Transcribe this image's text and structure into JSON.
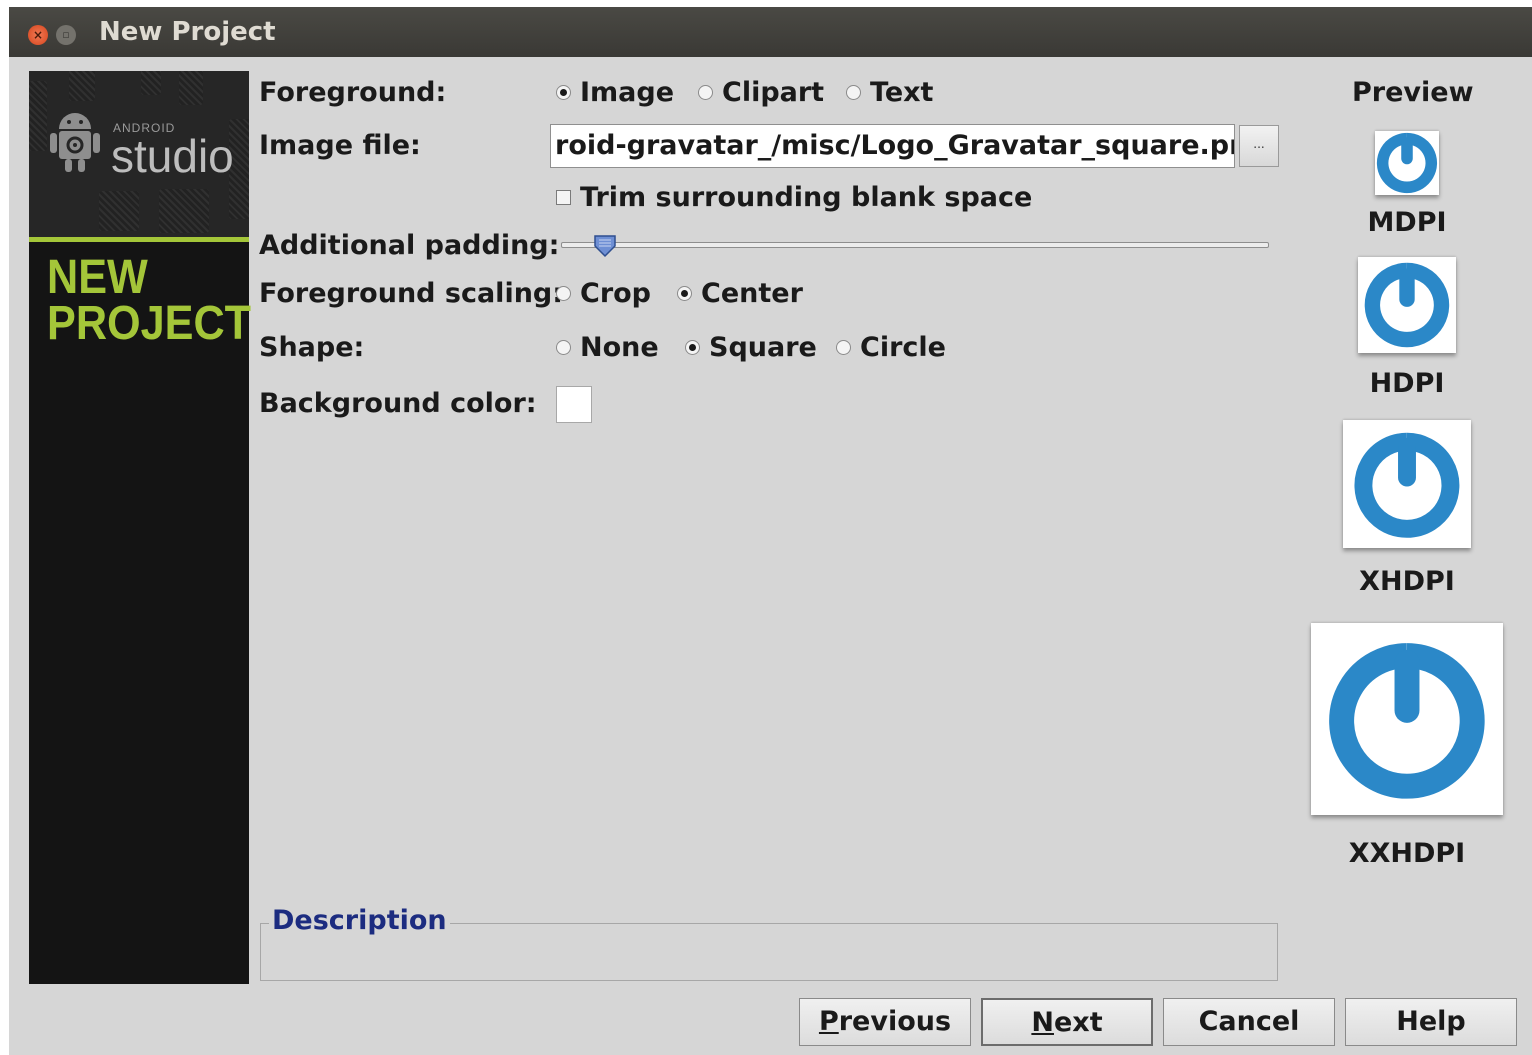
{
  "window": {
    "title": "New Project"
  },
  "sidebar": {
    "android": "ANDROID",
    "studio": "studio",
    "heading_line1": "NEW",
    "heading_line2": "PROJECT"
  },
  "form": {
    "foreground_label": "Foreground:",
    "foreground_options": [
      "Image",
      "Clipart",
      "Text"
    ],
    "foreground_selected": "Image",
    "image_file_label": "Image file:",
    "image_file_value": "roid-gravatar_/misc/Logo_Gravatar_square.png",
    "browse_label": "...",
    "trim_label": "Trim surrounding blank space",
    "trim_checked": false,
    "padding_label": "Additional padding:",
    "padding_value_fraction": 0.06,
    "scaling_label": "Foreground scaling:",
    "scaling_options": [
      "Crop",
      "Center"
    ],
    "scaling_selected": "Center",
    "shape_label": "Shape:",
    "shape_options": [
      "None",
      "Square",
      "Circle"
    ],
    "shape_selected": "Square",
    "bg_color_label": "Background color:",
    "bg_color": "#ffffff"
  },
  "description": {
    "title": "Description"
  },
  "preview": {
    "title": "Preview",
    "items": [
      {
        "label": "MDPI"
      },
      {
        "label": "HDPI"
      },
      {
        "label": "XHDPI"
      },
      {
        "label": "XXHDPI"
      }
    ],
    "icon_color": "#1e7fbf"
  },
  "buttons": {
    "previous": {
      "mnemonic": "P",
      "rest": "revious"
    },
    "next": {
      "mnemonic": "N",
      "rest": "ext"
    },
    "cancel": "Cancel",
    "help": "Help"
  },
  "colors": {
    "accent_green": "#a4c639",
    "description_title": "#1c2c80"
  }
}
